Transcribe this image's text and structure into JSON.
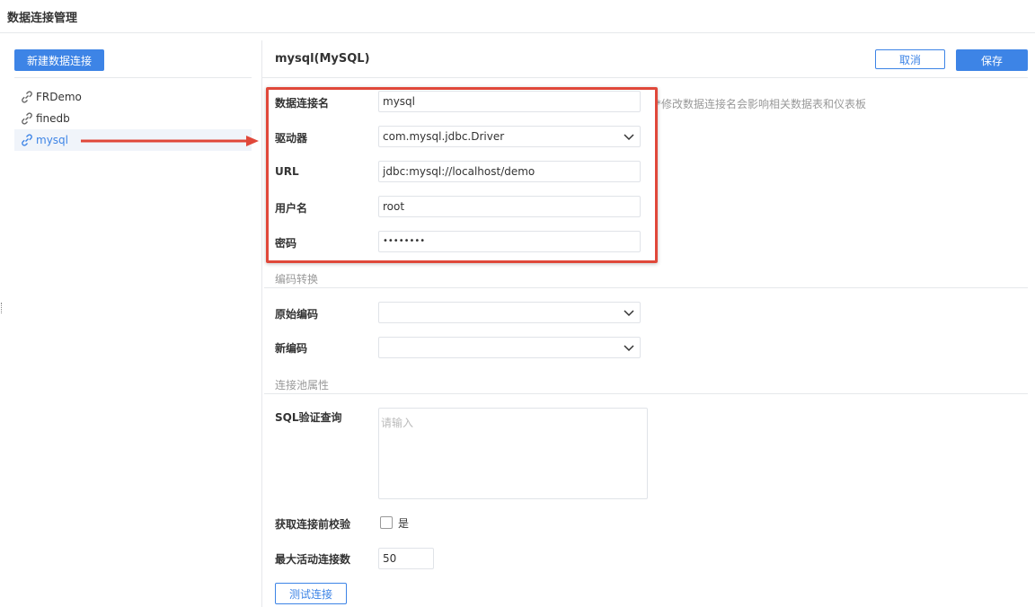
{
  "window": {
    "title": "数据连接管理"
  },
  "sidebar": {
    "new_button": "新建数据连接",
    "items": [
      {
        "label": "FRDemo",
        "icon": "link-icon"
      },
      {
        "label": "finedb",
        "icon": "link-icon"
      },
      {
        "label": "mysql",
        "icon": "link-icon",
        "selected": true
      }
    ]
  },
  "header": {
    "title": "mysql(MySQL)",
    "cancel_label": "取消",
    "save_label": "保存"
  },
  "form": {
    "name_label": "数据连接名",
    "name_value": "mysql",
    "name_hint": "*修改数据连接名会影响相关数据表和仪表板",
    "driver_label": "驱动器",
    "driver_value": "com.mysql.jdbc.Driver",
    "url_label": "URL",
    "url_value": "jdbc:mysql://localhost/demo",
    "user_label": "用户名",
    "user_value": "root",
    "password_label": "密码",
    "password_value": "••••••••"
  },
  "encoding": {
    "section_title": "编码转换",
    "original_label": "原始编码",
    "original_value": "",
    "new_label": "新编码",
    "new_value": ""
  },
  "pool": {
    "section_title": "连接池属性",
    "sql_label": "SQL验证查询",
    "sql_placeholder": "请输入",
    "validate_label": "获取连接前校验",
    "validate_option": "是",
    "validate_checked": false,
    "max_active_label": "最大活动连接数",
    "max_active_value": "50",
    "test_button": "测试连接"
  },
  "colors": {
    "accent": "#3d84e6",
    "highlight": "#e0483a"
  }
}
